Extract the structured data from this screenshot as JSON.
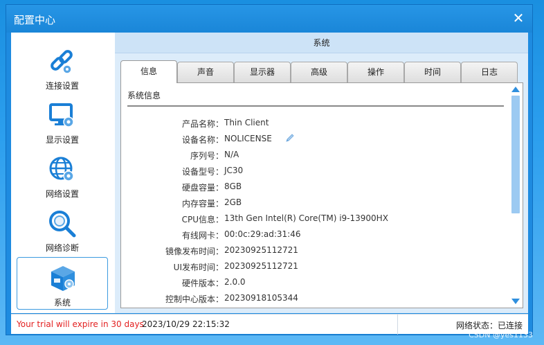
{
  "window": {
    "title": "配置中心",
    "close_glyph": "✕"
  },
  "sidebar": {
    "items": [
      {
        "label": "连接设置",
        "icon": "link-icon"
      },
      {
        "label": "显示设置",
        "icon": "monitor-icon"
      },
      {
        "label": "网络设置",
        "icon": "globe-icon"
      },
      {
        "label": "网络诊断",
        "icon": "magnifier-icon"
      },
      {
        "label": "系统",
        "icon": "system-box-icon",
        "active": true
      }
    ]
  },
  "main": {
    "header": "系统",
    "tabs": [
      "信息",
      "声音",
      "显示器",
      "高级",
      "操作",
      "时间",
      "日志"
    ],
    "active_tab": "信息",
    "section_title": "系统信息",
    "info": [
      {
        "key": "产品名称：",
        "value": "Thin Client"
      },
      {
        "key": "设备名称：",
        "value": "NOLICENSE",
        "editable": true
      },
      {
        "key": "序列号：",
        "value": "N/A"
      },
      {
        "key": "设备型号：",
        "value": "JC30"
      },
      {
        "key": "硬盘容量：",
        "value": "8GB"
      },
      {
        "key": "内存容量：",
        "value": "2GB"
      },
      {
        "key": "CPU信息：",
        "value": "13th Gen Intel(R) Core(TM) i9-13900HX"
      },
      {
        "key": "有线网卡：",
        "value": "00:0c:29:ad:31:46"
      },
      {
        "key": "镜像发布时间：",
        "value": "20230925112721"
      },
      {
        "key": "UI发布时间：",
        "value": "20230925112721"
      },
      {
        "key": "硬件版本：",
        "value": "2.0.0"
      },
      {
        "key": "控制中心版本：",
        "value": "20230918105344"
      }
    ]
  },
  "status": {
    "trial": "Your trial will expire in 30 days",
    "datetime": "2023/10/29 22:15:32",
    "network": "网络状态：已连接"
  },
  "watermark": "CSDN @yes1133",
  "colors": {
    "accent": "#1e8be0",
    "trial_text": "#e32020",
    "icon_blue": "#1a7fd6"
  }
}
